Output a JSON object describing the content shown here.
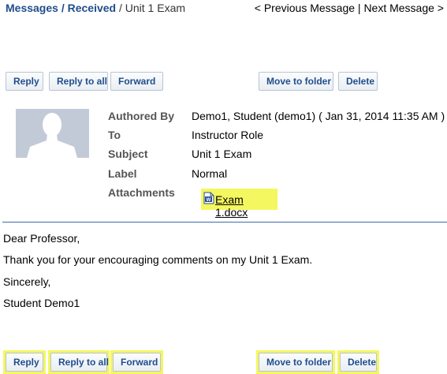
{
  "breadcrumb": {
    "messages": "Messages",
    "sep1": " / ",
    "received": "Received",
    "sep2": " / ",
    "current": "Unit 1 Exam"
  },
  "nav": {
    "previous": "< Previous Message",
    "divider": " | ",
    "next": "Next Message >"
  },
  "toolbar": {
    "reply": "Reply",
    "reply_all": "Reply to all",
    "forward": "Forward",
    "move": "Move to folder",
    "delete": "Delete"
  },
  "header": {
    "authored_by_label": "Authored By",
    "authored_by_value": "Demo1, Student (demo1) ( Jan 31, 2014 11:35 AM )",
    "to_label": "To",
    "to_value": "Instructor Role",
    "subject_label": "Subject",
    "subject_value": "Unit 1 Exam",
    "label_label": "Label",
    "label_value": "Normal",
    "attachments_label": "Attachments",
    "attachment_name": "Exam 1.docx",
    "attachment_icon": "word-document-icon"
  },
  "body": {
    "greeting": "Dear Professor,",
    "line1": "Thank you for your encouraging comments on my Unit 1 Exam.",
    "closing": "Sincerely,",
    "signature": "Student Demo1"
  },
  "colors": {
    "link": "#1f4e8c",
    "highlight": "#f4f75f",
    "divider": "#3c69a8",
    "avatar_bg": "#c3cad7"
  }
}
